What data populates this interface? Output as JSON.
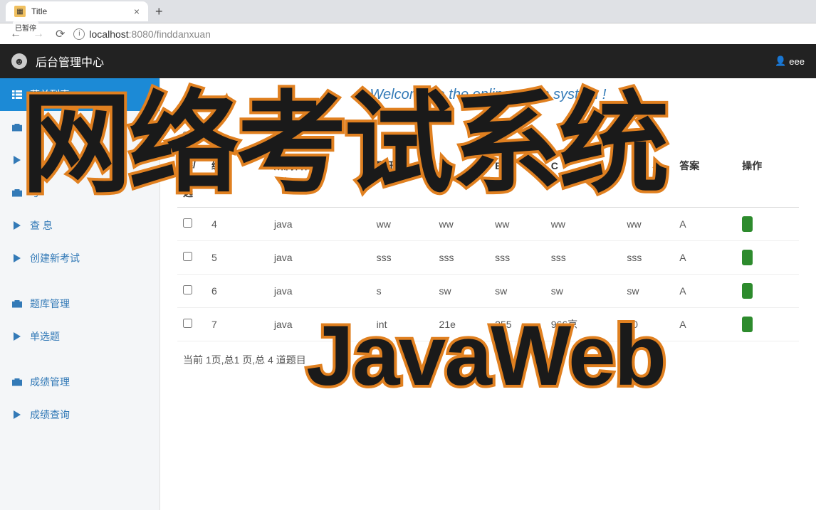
{
  "browser": {
    "tab_title": "Title",
    "badge": "已暂停",
    "url_host": "localhost",
    "url_port": ":8080",
    "url_path": "/finddanxuan"
  },
  "header": {
    "title": "后台管理中心",
    "user": "eee"
  },
  "sidebar": {
    "items": [
      {
        "label": "菜单列表",
        "icon": "list",
        "active": true
      },
      {
        "label": "系",
        "icon": "briefcase"
      },
      {
        "label": "学",
        "icon": "play"
      },
      {
        "label": "考",
        "icon": "briefcase"
      },
      {
        "label": "查        息",
        "icon": "play"
      },
      {
        "label": "创建新考试",
        "icon": "play"
      },
      {
        "label": "题库管理",
        "icon": "briefcase"
      },
      {
        "label": "单选题",
        "icon": "play"
      },
      {
        "label": "成绩管理",
        "icon": "briefcase"
      },
      {
        "label": "成绩查询",
        "icon": "play"
      }
    ]
  },
  "main": {
    "welcome": "Welcome to the online exam system !",
    "table": {
      "select_all": "全选/反选",
      "headers": [
        "编号",
        "所属科目",
        "题干",
        "A",
        "B",
        "C",
        "",
        "答案",
        "操作"
      ],
      "rows": [
        {
          "id": "4",
          "subject": "java",
          "stem": "ww",
          "a": "ww",
          "b": "ww",
          "c": "ww",
          "d": "ww",
          "answer": "A"
        },
        {
          "id": "5",
          "subject": "java",
          "stem": "sss",
          "a": "sss",
          "b": "sss",
          "c": "sss",
          "d": "sss",
          "answer": "A"
        },
        {
          "id": "6",
          "subject": "java",
          "stem": "s",
          "a": "sw",
          "b": "sw",
          "c": "sw",
          "d": "sw",
          "answer": "A"
        },
        {
          "id": "7",
          "subject": "java",
          "stem": "int",
          "a": "21e",
          "b": "255",
          "c": "966京",
          "d": "10",
          "answer": "A"
        }
      ]
    },
    "pagination": "当前 1页,总1 页,总 4 道题目"
  },
  "overlay": {
    "text1": "网络考试系统",
    "text2": "JavaWeb"
  }
}
